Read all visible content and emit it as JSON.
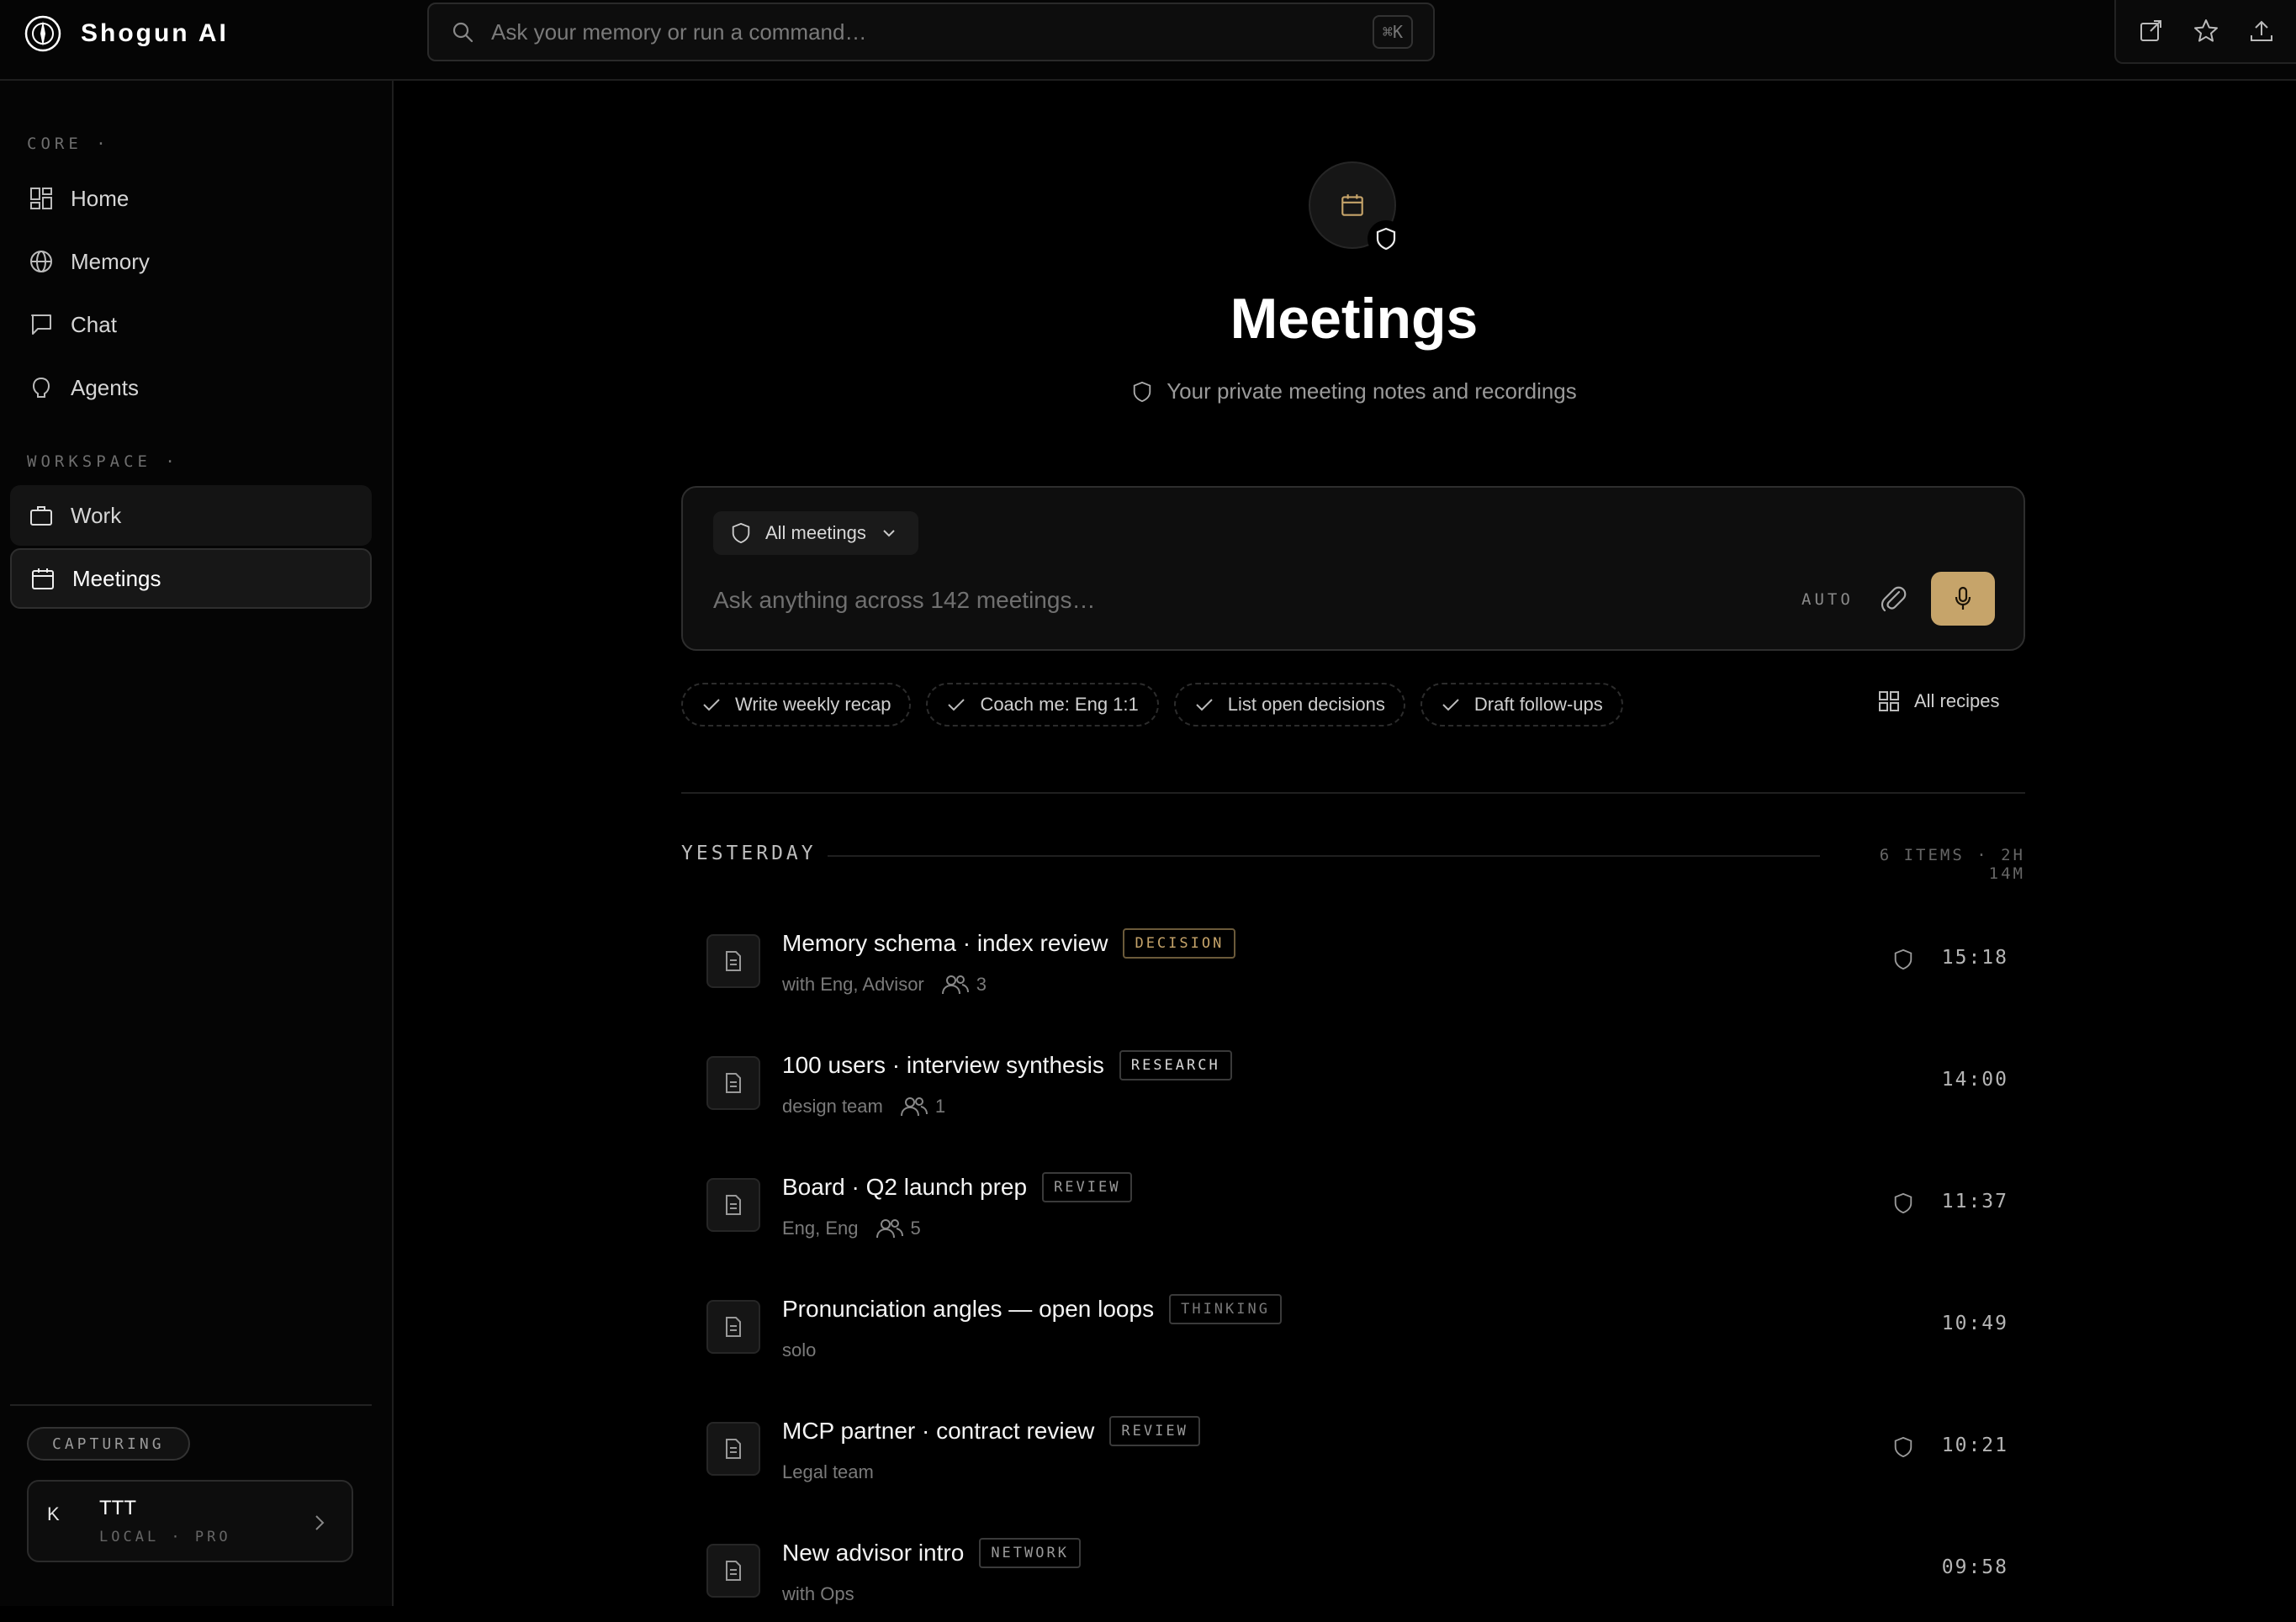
{
  "app": {
    "name": "Shogun AI"
  },
  "search": {
    "placeholder": "Ask your memory or run a command…",
    "shortcut": "⌘K"
  },
  "sidebar": {
    "core_label": "CORE ·",
    "core_items": [
      {
        "label": "Home",
        "icon": "grid-icon"
      },
      {
        "label": "Memory",
        "icon": "globe-icon"
      },
      {
        "label": "Chat",
        "icon": "chat-icon"
      },
      {
        "label": "Agents",
        "icon": "agent-icon"
      }
    ],
    "workspace_label": "WORKSPACE ·",
    "workspace_items": [
      {
        "label": "Work",
        "icon": "briefcase-icon"
      },
      {
        "label": "Meetings",
        "icon": "calendar-icon",
        "active": true
      }
    ],
    "status": "CAPTURING",
    "user": {
      "initial": "K",
      "name": "TTT",
      "plan": "LOCAL · PRO"
    }
  },
  "page": {
    "title": "Meetings",
    "subtitle": "Your private meeting notes and recordings"
  },
  "composer": {
    "scope": "All meetings",
    "placeholder": "Ask anything across 142 meetings…",
    "mode": "AUTO"
  },
  "recipes": {
    "chips": [
      "Write weekly recap",
      "Coach me: Eng 1:1",
      "List open decisions",
      "Draft follow-ups"
    ],
    "all_label": "All recipes"
  },
  "group": {
    "label": "YESTERDAY",
    "meta": "6 ITEMS · 2H 14M",
    "meetings": [
      {
        "title": "Memory schema · index review",
        "tag": "DECISION",
        "tag_color": "#c6a46a",
        "sub": "with Eng, Advisor",
        "people": "3",
        "private": true,
        "time": "15:18"
      },
      {
        "title": "100 users · interview synthesis",
        "tag": "RESEARCH",
        "tag_color": "#d8d8d8",
        "sub": "design team",
        "people": "1",
        "private": false,
        "time": "14:00"
      },
      {
        "title": "Board · Q2 launch prep",
        "tag": "REVIEW",
        "tag_color": "#9a9a9a",
        "sub": "Eng, Eng",
        "people": "5",
        "private": true,
        "time": "11:37"
      },
      {
        "title": "Pronunciation angles — open loops",
        "tag": "THINKING",
        "tag_color": "#7a7a7a",
        "sub": "solo",
        "people": "",
        "private": false,
        "time": "10:49"
      },
      {
        "title": "MCP partner · contract review",
        "tag": "REVIEW",
        "tag_color": "#9a9a9a",
        "sub": "Legal team",
        "people": "",
        "private": true,
        "time": "10:21"
      },
      {
        "title": "New advisor intro",
        "tag": "NETWORK",
        "tag_color": "#9a9a9a",
        "sub": "with Ops",
        "people": "",
        "private": false,
        "time": "09:58"
      }
    ]
  },
  "colors": {
    "accent": "#c6a46a",
    "background": "#000000"
  }
}
